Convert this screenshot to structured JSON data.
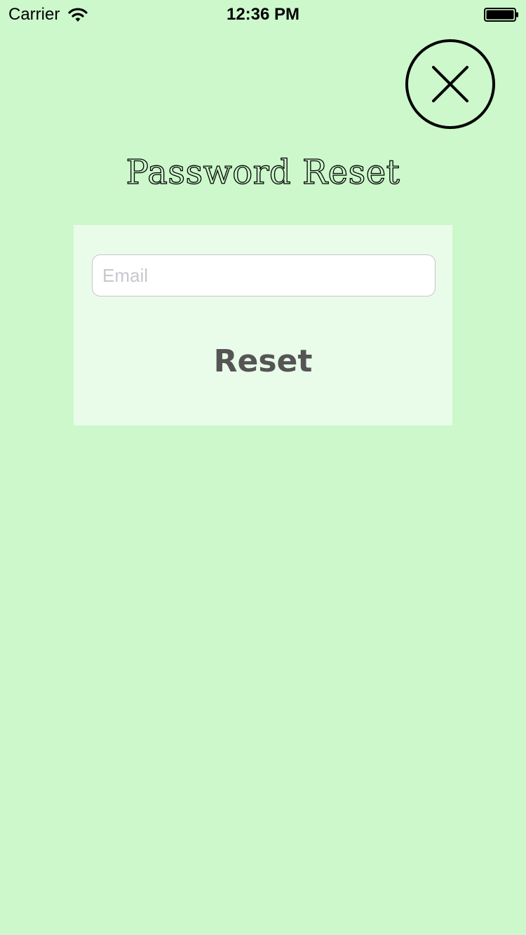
{
  "status_bar": {
    "carrier": "Carrier",
    "time": "12:36 PM",
    "wifi_icon": "wifi-icon",
    "battery_icon": "battery-icon"
  },
  "close_icon": "close-icon",
  "title": "Password Reset",
  "form": {
    "email": {
      "value": "",
      "placeholder": "Email"
    },
    "reset_label": "Reset"
  },
  "colors": {
    "background": "#ccf8cc",
    "panel": "#e9fce9",
    "button_text": "#555555",
    "placeholder": "#c7c7cd"
  }
}
